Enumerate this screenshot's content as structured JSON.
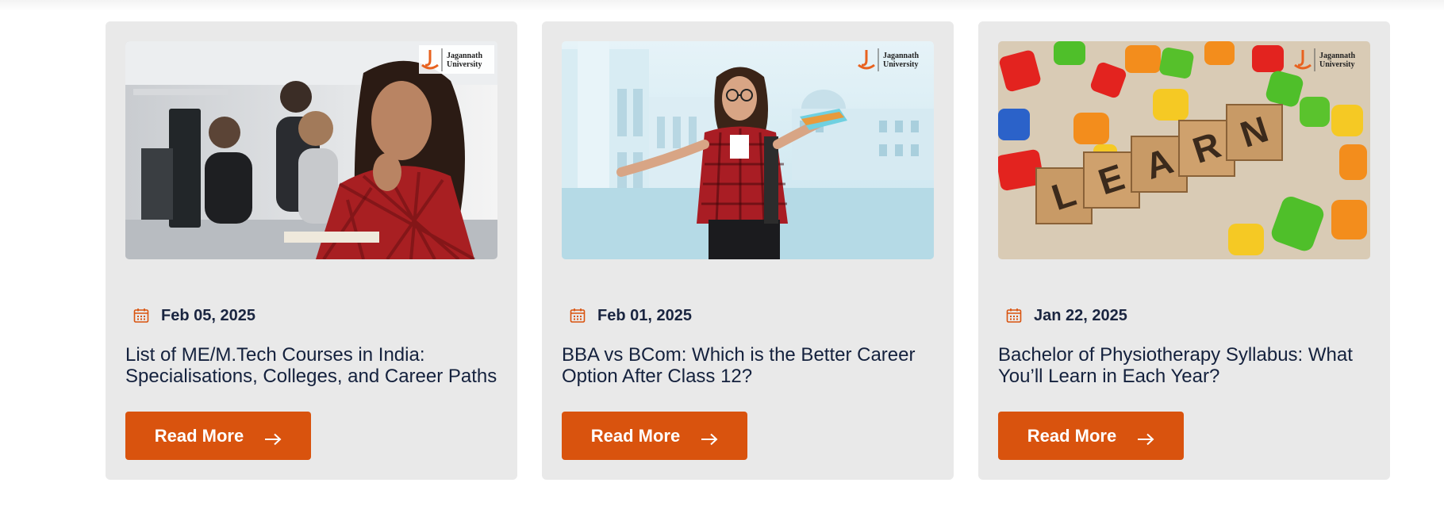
{
  "colors": {
    "card_background": "#e9e9e9",
    "button_background": "#d9530e",
    "button_text": "#ffffff",
    "heading_text": "#14213d",
    "calendar_icon": "#d9530e"
  },
  "logo": {
    "brand_line_1": "Jagannath",
    "brand_line_2": "University"
  },
  "cards": [
    {
      "date": "Feb 05, 2025",
      "title": "List of ME/M.Tech Courses in India: Specialisations, Colleges, and Career Paths",
      "button_label": "Read More",
      "button_icon": "arrow-right-icon",
      "image": "woman-in-computer-lab"
    },
    {
      "date": "Feb 01, 2025",
      "title": "BBA vs BCom: Which is the Better Career Option After Class 12?",
      "button_label": "Read More",
      "button_icon": "arrow-right-icon",
      "image": "student-shrugging-campus"
    },
    {
      "date": "Jan 22, 2025",
      "title": "Bachelor of Physiotherapy Syllabus: What You’ll Learn in Each Year?",
      "button_label": "Read More",
      "button_icon": "arrow-right-icon",
      "image": "learn-wooden-blocks",
      "image_blocks": [
        "L",
        "E",
        "A",
        "R",
        "N"
      ]
    }
  ]
}
